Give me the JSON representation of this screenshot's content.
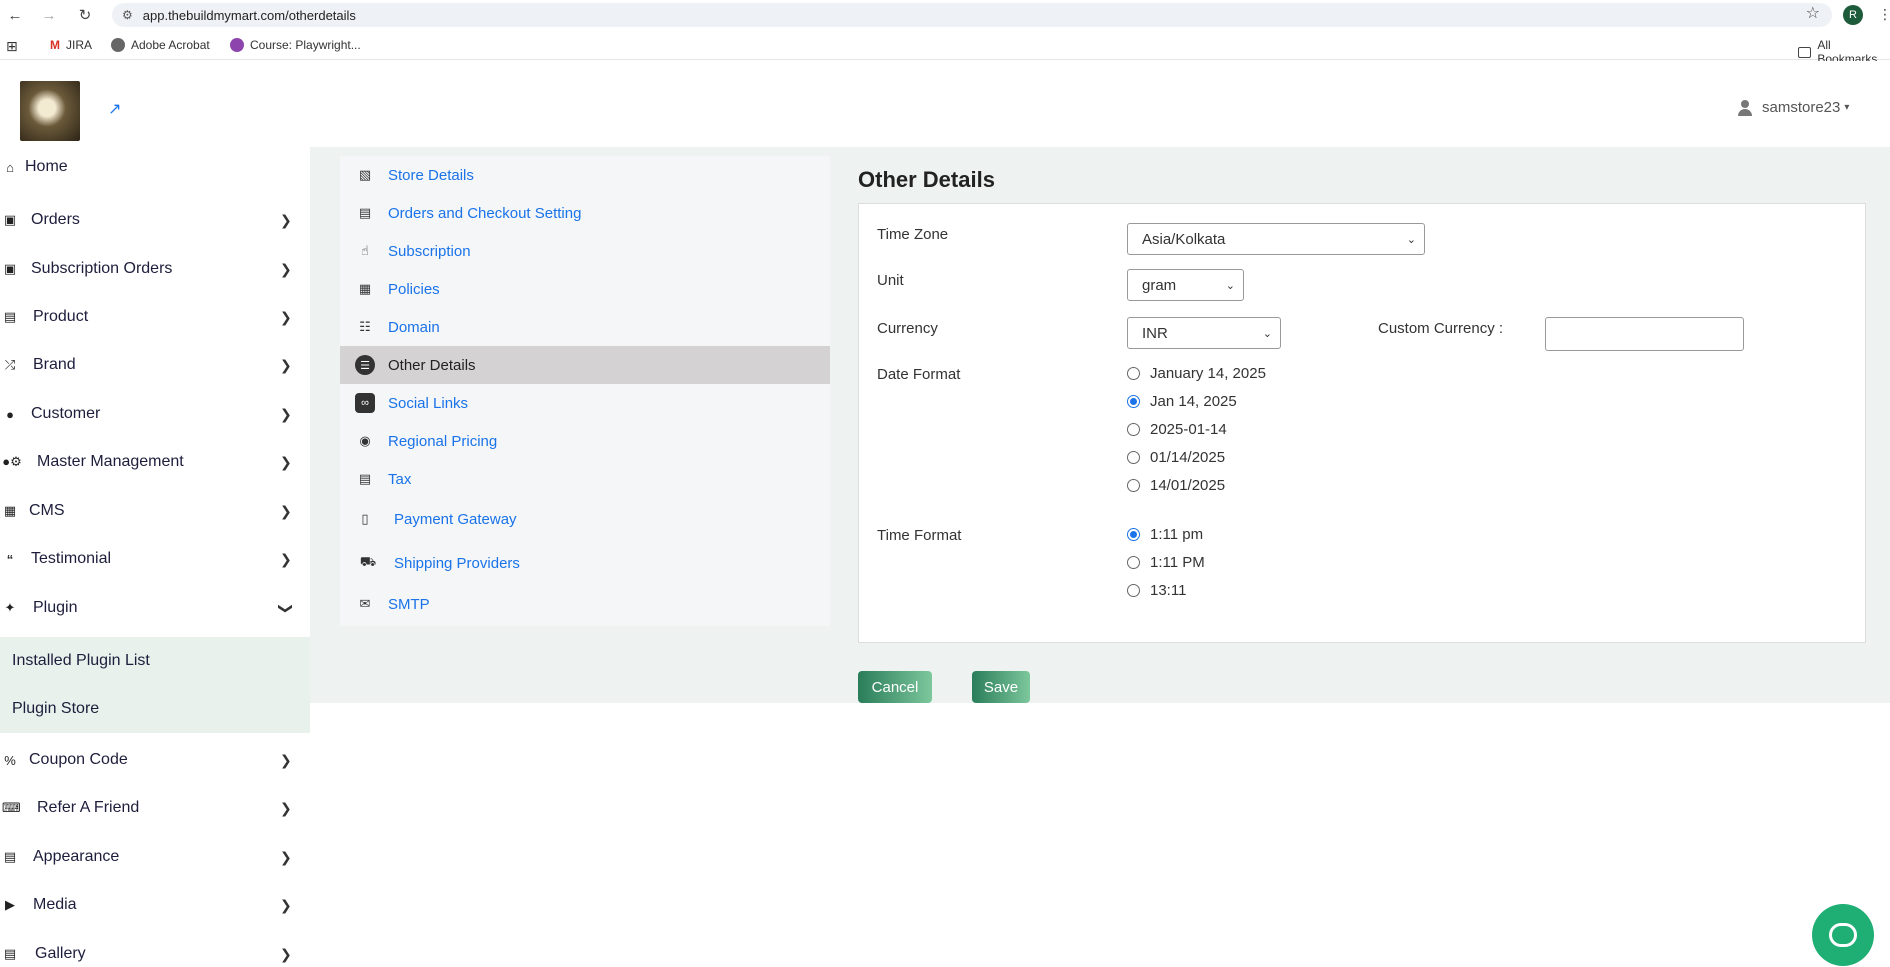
{
  "browser": {
    "url": "app.thebuildmymart.com/otherdetails",
    "profile_initial": "R",
    "bookmarks": [
      "JIRA",
      "Adobe Acrobat",
      "Course: Playwright...",
      "All Bookmarks"
    ]
  },
  "header": {
    "username": "samstore23"
  },
  "sidebar": {
    "items": [
      {
        "label": "Home",
        "icon": "home-icon"
      },
      {
        "label": "Orders",
        "icon": "bag-icon"
      },
      {
        "label": "Subscription Orders",
        "icon": "bag-icon"
      },
      {
        "label": "Product",
        "icon": "archive-icon"
      },
      {
        "label": "Brand",
        "icon": "shuffle-icon"
      },
      {
        "label": "Customer",
        "icon": "person-icon"
      },
      {
        "label": "Master Management",
        "icon": "user-gear-icon"
      },
      {
        "label": "CMS",
        "icon": "file-icon"
      },
      {
        "label": "Testimonial",
        "icon": "quote-icon"
      },
      {
        "label": "Plugin",
        "icon": "puzzle-icon"
      },
      {
        "label": "Coupon Code",
        "icon": "percent-icon"
      },
      {
        "label": "Refer A Friend",
        "icon": "keyboard-icon"
      },
      {
        "label": "Appearance",
        "icon": "image-icon"
      },
      {
        "label": "Media",
        "icon": "play-icon"
      },
      {
        "label": "Gallery",
        "icon": "images-icon"
      }
    ],
    "plugin_sub": [
      "Installed Plugin List",
      "Plugin Store"
    ]
  },
  "settings_menu": {
    "items": [
      {
        "label": "Store Details",
        "icon": "store-icon"
      },
      {
        "label": "Orders and Checkout Setting",
        "icon": "document-icon"
      },
      {
        "label": "Subscription",
        "icon": "subscription-icon"
      },
      {
        "label": "Policies",
        "icon": "policies-icon"
      },
      {
        "label": "Domain",
        "icon": "domain-icon"
      },
      {
        "label": "Other Details",
        "icon": "list-icon"
      },
      {
        "label": "Social Links",
        "icon": "link-icon"
      },
      {
        "label": "Regional Pricing",
        "icon": "globe-icon"
      },
      {
        "label": "Tax",
        "icon": "tax-icon"
      },
      {
        "label": "Payment Gateway",
        "icon": "payment-icon"
      },
      {
        "label": "Shipping Providers",
        "icon": "truck-icon"
      },
      {
        "label": "SMTP",
        "icon": "mail-icon"
      }
    ],
    "active": "Other Details"
  },
  "form": {
    "title": "Other Details",
    "time_zone_label": "Time Zone",
    "time_zone_value": "Asia/Kolkata",
    "unit_label": "Unit",
    "unit_value": "gram",
    "currency_label": "Currency",
    "currency_value": "INR",
    "custom_currency_label": "Custom Currency :",
    "custom_currency_value": "",
    "date_format_label": "Date Format",
    "date_formats": [
      "January 14, 2025",
      "Jan 14, 2025",
      "2025-01-14",
      "01/14/2025",
      "14/01/2025"
    ],
    "date_format_selected": "Jan 14, 2025",
    "time_format_label": "Time Format",
    "time_formats": [
      "1:11 pm",
      "1:11 PM",
      "13:11"
    ],
    "time_format_selected": "1:11 pm",
    "cancel_label": "Cancel",
    "save_label": "Save"
  },
  "colors": {
    "accent": "#1a73e8",
    "button_start": "#2a7d5a",
    "button_end": "#7dc79c",
    "chat": "#1fae74"
  }
}
